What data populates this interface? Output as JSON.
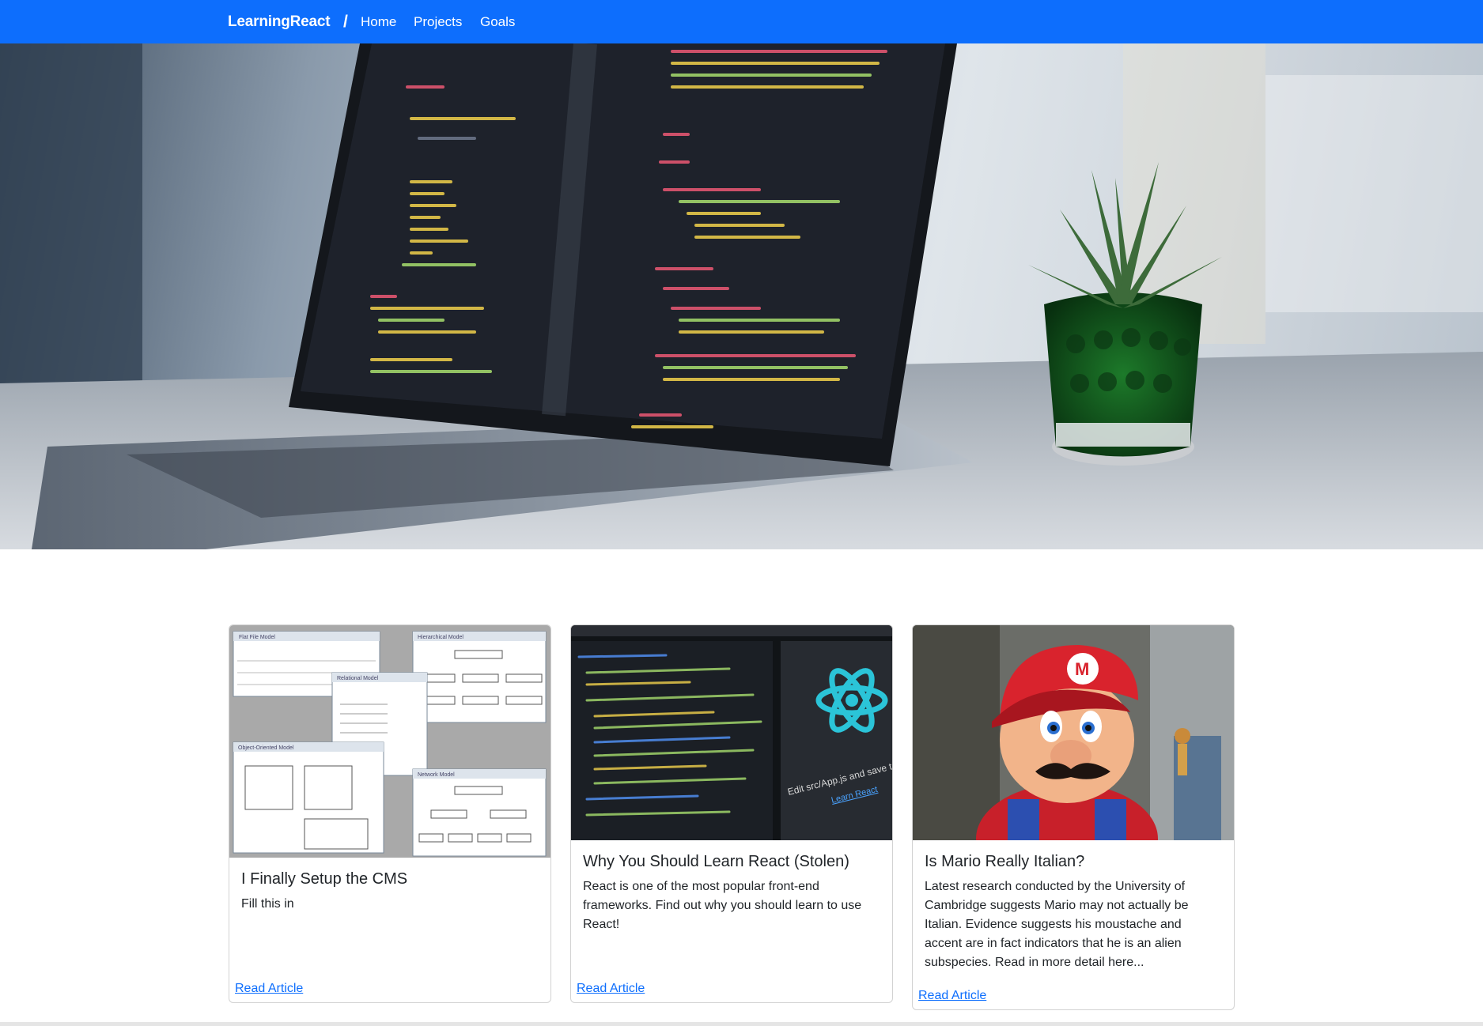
{
  "navbar": {
    "brand": "LearningReact",
    "separator": "/",
    "links": [
      {
        "label": "Home"
      },
      {
        "label": "Projects"
      },
      {
        "label": "Goals"
      }
    ],
    "background_color": "#0d6efd"
  },
  "hero": {
    "image_alt": "laptop with code editor and potted succulent"
  },
  "cards": [
    {
      "title": "I Finally Setup the CMS",
      "text": "Fill this in",
      "link": "Read Article"
    },
    {
      "title": "Why You Should Learn React (Stolen)",
      "text": "React is one of the most popular front-end frameworks. Find out why you should learn to use React!",
      "link": "Read Article"
    },
    {
      "title": "Is Mario Really Italian?",
      "text": "Latest research conducted by the University of Cambridge suggests Mario may not actually be Italian. Evidence suggests his moustache and accent are in fact indicators that he is an alien subspecies. Read in more detail here...",
      "link": "Read Article"
    }
  ],
  "card_images": {
    "db_models": {
      "flat_file": "Flat File Model",
      "hierarchical": "Hierarchical Model",
      "relational": "Relational Model",
      "object_oriented": "Object-Oriented Model",
      "network": "Network Model"
    },
    "react_editor": {
      "caption": "Edit src/App.js and save to re",
      "link": "Learn React"
    },
    "mario_cap_letter": "M"
  },
  "colors": {
    "link": "#0d6efd",
    "react_cyan": "#2bc4d8"
  }
}
